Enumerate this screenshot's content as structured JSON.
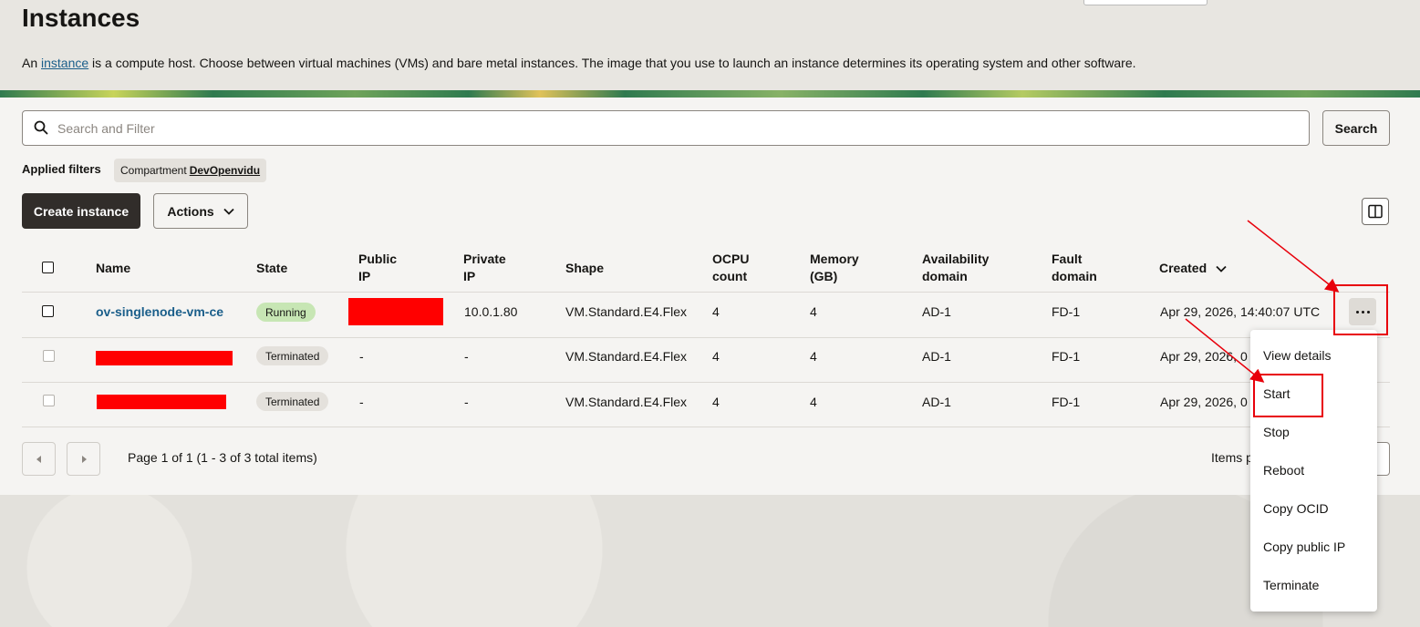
{
  "header": {
    "title": "Instances",
    "description_prefix": "An ",
    "description_link": "instance",
    "description_suffix": " is a compute host. Choose between virtual machines (VMs) and bare metal instances. The image that you use to launch an instance determines its operating system and other software."
  },
  "search": {
    "placeholder": "Search and Filter",
    "value": "",
    "button_label": "Search",
    "icon": "search-icon"
  },
  "filters": {
    "label": "Applied filters",
    "chip_key": "Compartment",
    "chip_value": "DevOpenvidu"
  },
  "toolbar": {
    "create_label": "Create instance",
    "actions_label": "Actions",
    "columns_icon": "columns-icon"
  },
  "table": {
    "columns": {
      "name": "Name",
      "state": "State",
      "public_ip_1": "Public",
      "public_ip_2": "IP",
      "private_ip_1": "Private",
      "private_ip_2": "IP",
      "shape": "Shape",
      "ocpu_1": "OCPU",
      "ocpu_2": "count",
      "memory_1": "Memory",
      "memory_2": "(GB)",
      "ad_1": "Availability",
      "ad_2": "domain",
      "fd_1": "Fault",
      "fd_2": "domain",
      "created": "Created"
    },
    "rows": [
      {
        "name": "ov-singlenode-vm-ce",
        "state": "Running",
        "public_ip": "[redacted]",
        "private_ip": "10.0.1.80",
        "shape": "VM.Standard.E4.Flex",
        "ocpu": "4",
        "memory": "4",
        "ad": "AD-1",
        "fd": "FD-1",
        "created": "Apr 29, 2026, 14:40:07 UTC"
      },
      {
        "name": "[redacted]",
        "state": "Terminated",
        "public_ip": "-",
        "private_ip": "-",
        "shape": "VM.Standard.E4.Flex",
        "ocpu": "4",
        "memory": "4",
        "ad": "AD-1",
        "fd": "FD-1",
        "created": "Apr 29, 2026, 0"
      },
      {
        "name": "[redacted]",
        "state": "Terminated",
        "public_ip": "-",
        "private_ip": "-",
        "shape": "VM.Standard.E4.Flex",
        "ocpu": "4",
        "memory": "4",
        "ad": "AD-1",
        "fd": "FD-1",
        "created": "Apr 29, 2026, 0"
      }
    ]
  },
  "pagination": {
    "info": "Page 1 of 1 (1 - 3 of 3 total items)",
    "items_per_page": "Items p"
  },
  "menu": {
    "items": [
      "View details",
      "Start",
      "Stop",
      "Reboot",
      "Copy OCID",
      "Copy public IP",
      "Terminate"
    ]
  },
  "colors": {
    "brand_dark": "#312d2a",
    "link": "#1a5e8a",
    "running_badge": "#c7e6b4",
    "annotation_red": "#e8000b"
  }
}
